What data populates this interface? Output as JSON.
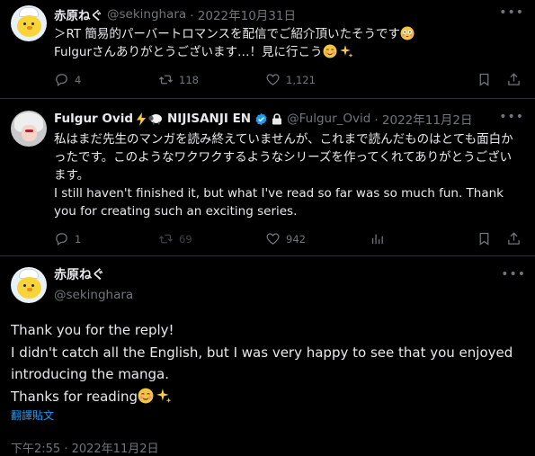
{
  "tweets": [
    {
      "name": "赤原ねぐ",
      "handle": "@sekinghara",
      "date": "· 2022年10月31日",
      "line1": "＞RT 簡易的パーバートロマンスを配信でご紹介頂いたそうです",
      "line2": "Fulgurさんありがとうございます…！見に行こう",
      "replies": "4",
      "retweets": "118",
      "likes": "1,121"
    },
    {
      "name": "Fulgur Ovid",
      "name_suffix": "NIJISANJI EN",
      "handle": "@Fulgur_Ovid",
      "date": "· 2022年11月2日",
      "body": "私はまだ先生のマンガを読み終えていませんが、これまで読んだものはとても面白かったです。このようなワクワクするようなシリーズを作ってくれてありがとうございます。",
      "body_en": "I still haven't finished it, but what I've read so far was so much fun. Thank you for creating such an exciting series.",
      "replies": "1",
      "retweets": "69",
      "likes": "942"
    }
  ],
  "main_tweet": {
    "name": "赤原ねぐ",
    "handle": "@sekinghara",
    "line1": "Thank you for the reply!",
    "line2": "I didn't catch all the English, but I was very happy to see that you enjoyed introducing the manga.",
    "line3": "Thanks for reading",
    "translate": "翻譯貼文",
    "timestamp": "下午2:55 · 2022年11月2日"
  },
  "colors": {
    "background": "#000000",
    "text": "#e7e9ea",
    "muted": "#71767b",
    "accent": "#1d9bf0",
    "verified": "#1d9bf0"
  },
  "icons": [
    "reply-icon",
    "retweet-icon",
    "like-icon",
    "bookmark-icon",
    "share-icon",
    "more-icon",
    "verified-icon",
    "lock-icon"
  ]
}
